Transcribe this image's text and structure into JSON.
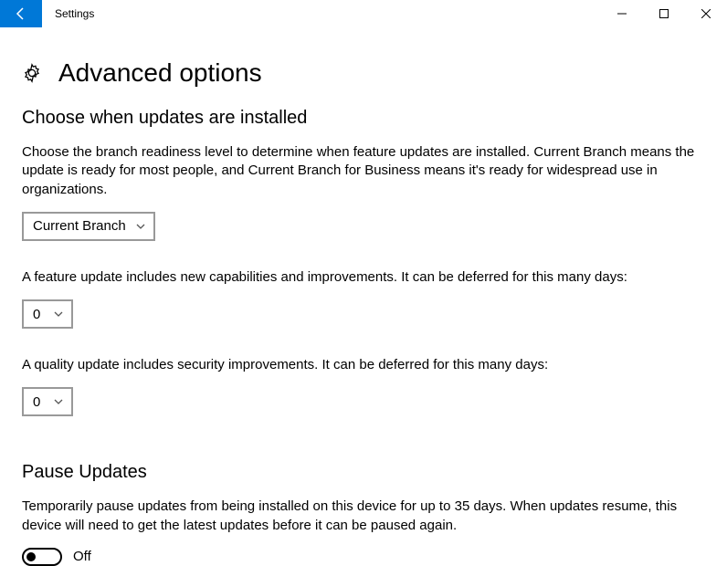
{
  "window": {
    "title": "Settings"
  },
  "page": {
    "title": "Advanced options"
  },
  "section_choose": {
    "heading": "Choose when updates are installed",
    "description": "Choose the branch readiness level to determine when feature updates are installed. Current Branch means the update is ready for most people, and Current Branch for Business means it's ready for widespread use in organizations.",
    "branch_value": "Current Branch",
    "feature_description": "A feature update includes new capabilities and improvements. It can be deferred for this many days:",
    "feature_days_value": "0",
    "quality_description": "A quality update includes security improvements. It can be deferred for this many days:",
    "quality_days_value": "0"
  },
  "section_pause": {
    "heading": "Pause Updates",
    "description": "Temporarily pause updates from being installed on this device for up to 35 days. When updates resume, this device will need to get the latest updates before it can be paused again.",
    "toggle_state": "Off"
  }
}
